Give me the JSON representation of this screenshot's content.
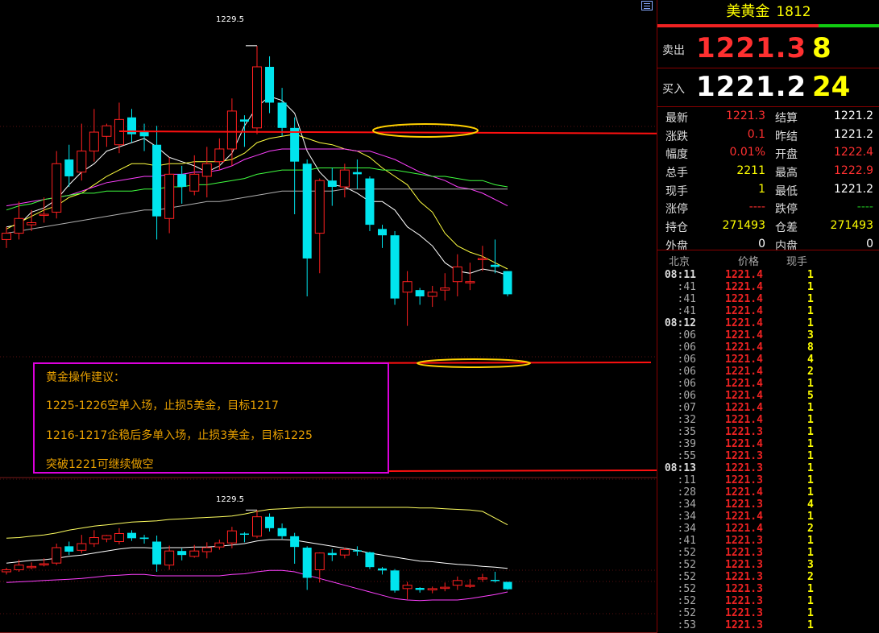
{
  "panel": {
    "title": "美黄金",
    "code": "1812",
    "sell": {
      "label": "卖出",
      "price": "1221.3",
      "volume": "8"
    },
    "buy": {
      "label": "买入",
      "price": "1221.2",
      "volume": "24"
    },
    "stats": [
      {
        "l1": "最新",
        "v1": "1221.3",
        "c1": "#ff3030",
        "l2": "结算",
        "v2": "1221.2",
        "c2": "#ffffff"
      },
      {
        "l1": "涨跌",
        "v1": "0.1",
        "c1": "#ff3030",
        "l2": "昨结",
        "v2": "1221.2",
        "c2": "#ffffff"
      },
      {
        "l1": "幅度",
        "v1": "0.01%",
        "c1": "#ff3030",
        "l2": "开盘",
        "v2": "1222.4",
        "c2": "#ff3030"
      },
      {
        "l1": "总手",
        "v1": "2211",
        "c1": "#ffff00",
        "l2": "最高",
        "v2": "1222.9",
        "c2": "#ff3030"
      },
      {
        "l1": "现手",
        "v1": "1",
        "c1": "#ffff00",
        "l2": "最低",
        "v2": "1221.2",
        "c2": "#ffffff"
      },
      {
        "l1": "涨停",
        "v1": "----",
        "c1": "#ff3030",
        "l2": "跌停",
        "v2": "----",
        "c2": "#20c020"
      },
      {
        "l1": "持仓",
        "v1": "271493",
        "c1": "#ffff00",
        "l2": "仓差",
        "v2": "271493",
        "c2": "#ffff00"
      },
      {
        "l1": "外盘",
        "v1": "0",
        "c1": "#ffffff",
        "l2": "内盘",
        "v2": "0",
        "c2": "#ffffff"
      }
    ],
    "tick_headers": {
      "time": "北京",
      "price": "价格",
      "volume": "现手"
    },
    "ticks": [
      {
        "t": "08:11",
        "p": "1221.4",
        "v": "1"
      },
      {
        "t": ":41",
        "p": "1221.4",
        "v": "1"
      },
      {
        "t": ":41",
        "p": "1221.4",
        "v": "1"
      },
      {
        "t": ":41",
        "p": "1221.4",
        "v": "1"
      },
      {
        "t": "08:12",
        "p": "1221.4",
        "v": "1"
      },
      {
        "t": ":06",
        "p": "1221.4",
        "v": "3"
      },
      {
        "t": ":06",
        "p": "1221.4",
        "v": "8"
      },
      {
        "t": ":06",
        "p": "1221.4",
        "v": "4"
      },
      {
        "t": ":06",
        "p": "1221.4",
        "v": "2"
      },
      {
        "t": ":06",
        "p": "1221.4",
        "v": "1"
      },
      {
        "t": ":06",
        "p": "1221.4",
        "v": "5"
      },
      {
        "t": ":07",
        "p": "1221.4",
        "v": "1"
      },
      {
        "t": ":32",
        "p": "1221.4",
        "v": "1"
      },
      {
        "t": ":35",
        "p": "1221.3",
        "v": "1"
      },
      {
        "t": ":39",
        "p": "1221.4",
        "v": "1"
      },
      {
        "t": ":55",
        "p": "1221.3",
        "v": "1"
      },
      {
        "t": "08:13",
        "p": "1221.3",
        "v": "1"
      },
      {
        "t": ":11",
        "p": "1221.3",
        "v": "1"
      },
      {
        "t": ":28",
        "p": "1221.4",
        "v": "1"
      },
      {
        "t": ":34",
        "p": "1221.3",
        "v": "4"
      },
      {
        "t": ":34",
        "p": "1221.4",
        "v": "1"
      },
      {
        "t": ":34",
        "p": "1221.4",
        "v": "2"
      },
      {
        "t": ":41",
        "p": "1221.3",
        "v": "1"
      },
      {
        "t": ":52",
        "p": "1221.3",
        "v": "1"
      },
      {
        "t": ":52",
        "p": "1221.3",
        "v": "3"
      },
      {
        "t": ":52",
        "p": "1221.3",
        "v": "2"
      },
      {
        "t": ":52",
        "p": "1221.3",
        "v": "1"
      },
      {
        "t": ":52",
        "p": "1221.3",
        "v": "1"
      },
      {
        "t": ":52",
        "p": "1221.3",
        "v": "1"
      },
      {
        "t": ":53",
        "p": "1221.3",
        "v": "1"
      }
    ]
  },
  "advice": {
    "title": "黄金操作建议：",
    "line1": "1225-1226空单入场，止损5美金，目标1217",
    "line2": "1216-1217企稳后多单入场，止损3美金，目标1225",
    "line3": "突破1221可继续做空"
  },
  "colors": {
    "up": "#ff2020",
    "down": "#00e5ee"
  },
  "chart_data": {
    "type": "candlestick",
    "high_label_top": "1229.5",
    "high_label_bottom": "1229.5",
    "top_ylim": [
      1214.4,
      1231.8
    ],
    "bottom_ylim": [
      1215.0,
      1233.0
    ],
    "candles": [
      {
        "o": 1221.0,
        "h": 1221.6,
        "c": 1221.3,
        "l": 1220.6
      },
      {
        "o": 1221.3,
        "h": 1222.8,
        "c": 1222.0,
        "l": 1221.0
      },
      {
        "o": 1221.7,
        "h": 1222.4,
        "c": 1221.8,
        "l": 1221.4
      },
      {
        "o": 1222.2,
        "h": 1223.0,
        "c": 1222.2,
        "l": 1221.8
      },
      {
        "o": 1222.3,
        "h": 1225.2,
        "c": 1224.6,
        "l": 1222.0
      },
      {
        "o": 1224.8,
        "h": 1225.5,
        "c": 1224.0,
        "l": 1223.5
      },
      {
        "o": 1224.2,
        "h": 1226.5,
        "c": 1225.2,
        "l": 1223.8
      },
      {
        "o": 1225.2,
        "h": 1227.2,
        "c": 1226.1,
        "l": 1224.7
      },
      {
        "o": 1225.9,
        "h": 1226.5,
        "c": 1226.4,
        "l": 1225.4
      },
      {
        "o": 1225.5,
        "h": 1227.5,
        "c": 1226.7,
        "l": 1225.1
      },
      {
        "o": 1226.8,
        "h": 1227.2,
        "c": 1226.0,
        "l": 1225.6
      },
      {
        "o": 1226.1,
        "h": 1226.5,
        "c": 1225.9,
        "l": 1225.2
      },
      {
        "o": 1225.5,
        "h": 1226.4,
        "c": 1222.1,
        "l": 1221.0
      },
      {
        "o": 1222.0,
        "h": 1224.9,
        "c": 1224.1,
        "l": 1221.3
      },
      {
        "o": 1224.1,
        "h": 1224.5,
        "c": 1223.5,
        "l": 1222.7
      },
      {
        "o": 1223.3,
        "h": 1225.0,
        "c": 1224.1,
        "l": 1223.1
      },
      {
        "o": 1224.0,
        "h": 1225.4,
        "c": 1224.6,
        "l": 1223.0
      },
      {
        "o": 1224.7,
        "h": 1225.8,
        "c": 1225.3,
        "l": 1224.3
      },
      {
        "o": 1225.3,
        "h": 1227.7,
        "c": 1227.1,
        "l": 1224.5
      },
      {
        "o": 1226.7,
        "h": 1226.9,
        "c": 1226.6,
        "l": 1225.4
      },
      {
        "o": 1226.3,
        "h": 1230.2,
        "c": 1229.2,
        "l": 1226.0
      },
      {
        "o": 1229.2,
        "h": 1229.7,
        "c": 1227.5,
        "l": 1227.0
      },
      {
        "o": 1227.5,
        "h": 1228.2,
        "c": 1226.3,
        "l": 1225.9
      },
      {
        "o": 1226.3,
        "h": 1226.8,
        "c": 1224.7,
        "l": 1222.2
      },
      {
        "o": 1224.6,
        "h": 1224.8,
        "c": 1220.1,
        "l": 1218.3
      },
      {
        "o": 1221.3,
        "h": 1223.9,
        "c": 1223.8,
        "l": 1219.4
      },
      {
        "o": 1223.8,
        "h": 1224.4,
        "c": 1223.5,
        "l": 1222.6
      },
      {
        "o": 1223.5,
        "h": 1224.6,
        "c": 1224.3,
        "l": 1223.0
      },
      {
        "o": 1224.2,
        "h": 1224.8,
        "c": 1224.1,
        "l": 1223.4
      },
      {
        "o": 1223.9,
        "h": 1224.0,
        "c": 1221.7,
        "l": 1221.4
      },
      {
        "o": 1221.5,
        "h": 1221.7,
        "c": 1221.2,
        "l": 1220.6
      },
      {
        "o": 1221.2,
        "h": 1221.4,
        "c": 1218.2,
        "l": 1217.9
      },
      {
        "o": 1218.5,
        "h": 1219.5,
        "c": 1219.0,
        "l": 1216.9
      },
      {
        "o": 1218.6,
        "h": 1218.7,
        "c": 1218.3,
        "l": 1217.9
      },
      {
        "o": 1218.3,
        "h": 1218.8,
        "c": 1218.5,
        "l": 1217.8
      },
      {
        "o": 1218.6,
        "h": 1219.4,
        "c": 1218.7,
        "l": 1218.1
      },
      {
        "o": 1219.0,
        "h": 1220.3,
        "c": 1219.7,
        "l": 1218.3
      },
      {
        "o": 1219.0,
        "h": 1219.9,
        "c": 1219.0,
        "l": 1218.6
      },
      {
        "o": 1220.1,
        "h": 1220.7,
        "c": 1220.1,
        "l": 1219.5
      },
      {
        "o": 1219.8,
        "h": 1221.0,
        "c": 1219.7,
        "l": 1219.4
      },
      {
        "o": 1219.5,
        "h": 1219.5,
        "c": 1218.4,
        "l": 1218.3
      }
    ],
    "top_lines": [
      {
        "color": "#ffffff",
        "values": [
          1221.6,
          1221.7,
          1222.3,
          1222.5,
          1222.9,
          1223.6,
          1224.2,
          1224.6,
          1225.2,
          1225.4,
          1225.6,
          1225.8,
          1225.4,
          1224.9,
          1224.7,
          1224.5,
          1224.2,
          1224.5,
          1225.1,
          1226.4,
          1227.3,
          1227.8,
          1227.6,
          1227.0,
          1225.2,
          1224.2,
          1223.6,
          1223.5,
          1223.2,
          1222.8,
          1222.8,
          1222.4,
          1221.6,
          1221.2,
          1220.7,
          1219.9,
          1219.5,
          1219.4,
          1219.6,
          1219.5,
          1219.3
        ]
      },
      {
        "color": "#ffff40",
        "values": [
          1221.5,
          1221.8,
          1222.1,
          1222.4,
          1222.6,
          1223.0,
          1223.2,
          1223.6,
          1224.0,
          1224.3,
          1224.6,
          1224.6,
          1224.5,
          1224.6,
          1224.6,
          1224.7,
          1224.7,
          1224.7,
          1224.8,
          1225.1,
          1225.6,
          1225.8,
          1225.9,
          1226.0,
          1225.8,
          1225.6,
          1225.5,
          1225.3,
          1225.2,
          1224.9,
          1224.4,
          1224.0,
          1223.6,
          1222.8,
          1222.3,
          1221.3,
          1220.7,
          1220.4,
          1220.2,
          1219.9,
          1219.6
        ]
      },
      {
        "color": "#ff40ff",
        "values": [
          1222.6,
          1222.7,
          1222.8,
          1222.9,
          1223.0,
          1223.1,
          1223.3,
          1223.5,
          1223.7,
          1223.8,
          1223.9,
          1224.0,
          1224.0,
          1224.1,
          1224.1,
          1224.2,
          1224.2,
          1224.3,
          1224.5,
          1224.8,
          1225.0,
          1225.2,
          1225.3,
          1225.3,
          1225.3,
          1225.3,
          1225.3,
          1225.3,
          1225.2,
          1225.2,
          1225.0,
          1224.8,
          1224.5,
          1224.2,
          1224.0,
          1223.8,
          1223.5,
          1223.4,
          1223.2,
          1222.9,
          1222.6
        ]
      },
      {
        "color": "#40ff40",
        "values": [
          1222.4,
          1222.6,
          1222.7,
          1222.9,
          1223.0,
          1223.1,
          1223.2,
          1223.2,
          1223.3,
          1223.3,
          1223.3,
          1223.4,
          1223.4,
          1223.5,
          1223.5,
          1223.6,
          1223.6,
          1223.7,
          1223.8,
          1223.9,
          1224.1,
          1224.2,
          1224.3,
          1224.3,
          1224.3,
          1224.4,
          1224.4,
          1224.4,
          1224.4,
          1224.4,
          1224.3,
          1224.3,
          1224.2,
          1224.1,
          1224.0,
          1224.0,
          1223.9,
          1223.8,
          1223.8,
          1223.6,
          1223.5
        ]
      },
      {
        "color": "#b0b0b0",
        "values": [
          1221.3,
          1221.4,
          1221.5,
          1221.6,
          1221.7,
          1221.8,
          1221.9,
          1222.0,
          1222.1,
          1222.2,
          1222.3,
          1222.4,
          1222.4,
          1222.5,
          1222.6,
          1222.7,
          1222.8,
          1222.8,
          1222.9,
          1223.0,
          1223.1,
          1223.2,
          1223.3,
          1223.3,
          1223.3,
          1223.3,
          1223.3,
          1223.4,
          1223.4,
          1223.4,
          1223.4,
          1223.4,
          1223.4,
          1223.4,
          1223.4,
          1223.4,
          1223.4,
          1223.4,
          1223.4,
          1223.4,
          1223.4
        ]
      }
    ],
    "bottom_lines": [
      {
        "color": "#ffff60",
        "values": [
          1226.0,
          1226.1,
          1226.3,
          1226.5,
          1226.8,
          1227.2,
          1227.5,
          1227.8,
          1228.0,
          1228.2,
          1228.4,
          1228.5,
          1228.6,
          1228.8,
          1228.9,
          1229.0,
          1229.1,
          1229.2,
          1229.3,
          1229.6,
          1230.0,
          1230.3,
          1230.4,
          1230.5,
          1230.6,
          1230.6,
          1230.6,
          1230.6,
          1230.6,
          1230.6,
          1230.6,
          1230.6,
          1230.6,
          1230.5,
          1230.5,
          1230.4,
          1230.3,
          1230.2,
          1230.0,
          1229.0,
          1228.0
        ]
      },
      {
        "color": "#ffffff",
        "values": [
          1222.3,
          1222.5,
          1222.7,
          1222.8,
          1223.0,
          1223.3,
          1223.5,
          1223.8,
          1224.1,
          1224.4,
          1224.6,
          1224.6,
          1224.5,
          1224.6,
          1224.6,
          1224.7,
          1224.7,
          1224.8,
          1225.0,
          1225.2,
          1225.6,
          1225.8,
          1225.8,
          1225.7,
          1225.4,
          1225.1,
          1224.8,
          1224.5,
          1224.2,
          1223.8,
          1223.5,
          1223.2,
          1222.9,
          1222.6,
          1222.5,
          1222.3,
          1222.1,
          1222.0,
          1221.8,
          1221.7,
          1221.5
        ]
      },
      {
        "color": "#ff40ff",
        "values": [
          1219.4,
          1219.5,
          1219.6,
          1219.7,
          1219.8,
          1219.9,
          1220.0,
          1220.2,
          1220.4,
          1220.5,
          1220.6,
          1220.6,
          1220.4,
          1220.4,
          1220.4,
          1220.4,
          1220.4,
          1220.4,
          1220.6,
          1220.7,
          1221.0,
          1221.2,
          1221.2,
          1221.0,
          1220.5,
          1220.0,
          1219.5,
          1219.0,
          1218.5,
          1218.0,
          1217.5,
          1217.0,
          1216.8,
          1216.7,
          1216.8,
          1216.8,
          1216.8,
          1217.0,
          1217.3,
          1217.6,
          1218.0
        ]
      }
    ]
  }
}
